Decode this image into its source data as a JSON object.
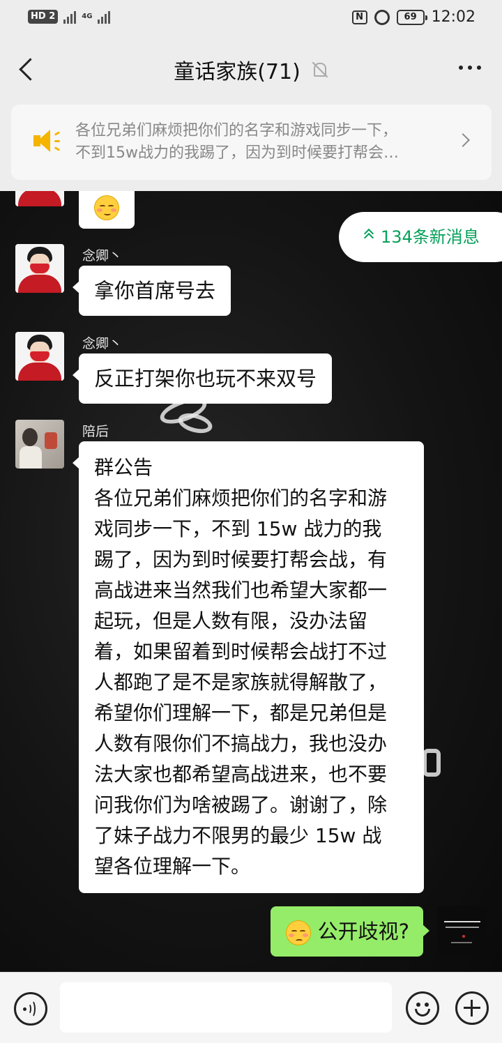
{
  "status_bar": {
    "hd_label": "HD",
    "sim_label": "2",
    "network_label": "4G",
    "battery": "69",
    "time": "12:02"
  },
  "header": {
    "title": "童话家族(71)"
  },
  "announcement_banner": {
    "line1": "各位兄弟们麻烦把你们的名字和游戏同步一下，",
    "line2": "不到15w战力的我踢了，因为到时候要打帮会…"
  },
  "new_messages_pill": {
    "label": "134条新消息"
  },
  "messages": [
    {
      "sender": "",
      "type": "emoji",
      "emoji": "smiling-face"
    },
    {
      "sender": "念卿丶",
      "text": "拿你首席号去"
    },
    {
      "sender": "念卿丶",
      "text": "反正打架你也玩不来双号"
    },
    {
      "sender": "陪后",
      "title": "群公告",
      "lines": [
        "各位兄弟们麻烦把你们的名字和游",
        "戏同步一下，不到 15w 战力的我",
        "踢了，因为到时候要打帮会战，有",
        "高战进来当然我们也希望大家都一",
        "起玩，但是人数有限，没办法留",
        "着，如果留着到时候帮会战打不过",
        "人都跑了是不是家族就得解散了，",
        "希望你们理解一下，都是兄弟但是",
        "人数有限你们不搞战力，我也没办",
        "法大家也都希望高战进来，也不要",
        "问我你们为啥被踢了。谢谢了，除",
        "了妹子战力不限男的最少 15w 战",
        "望各位理解一下。"
      ]
    },
    {
      "sender": "me",
      "emoji": "unamused-face",
      "text": "公开歧视?"
    }
  ],
  "colors": {
    "accent_green": "#07a05a",
    "my_bubble": "#95ec69",
    "speaker_yellow": "#f5b400"
  }
}
